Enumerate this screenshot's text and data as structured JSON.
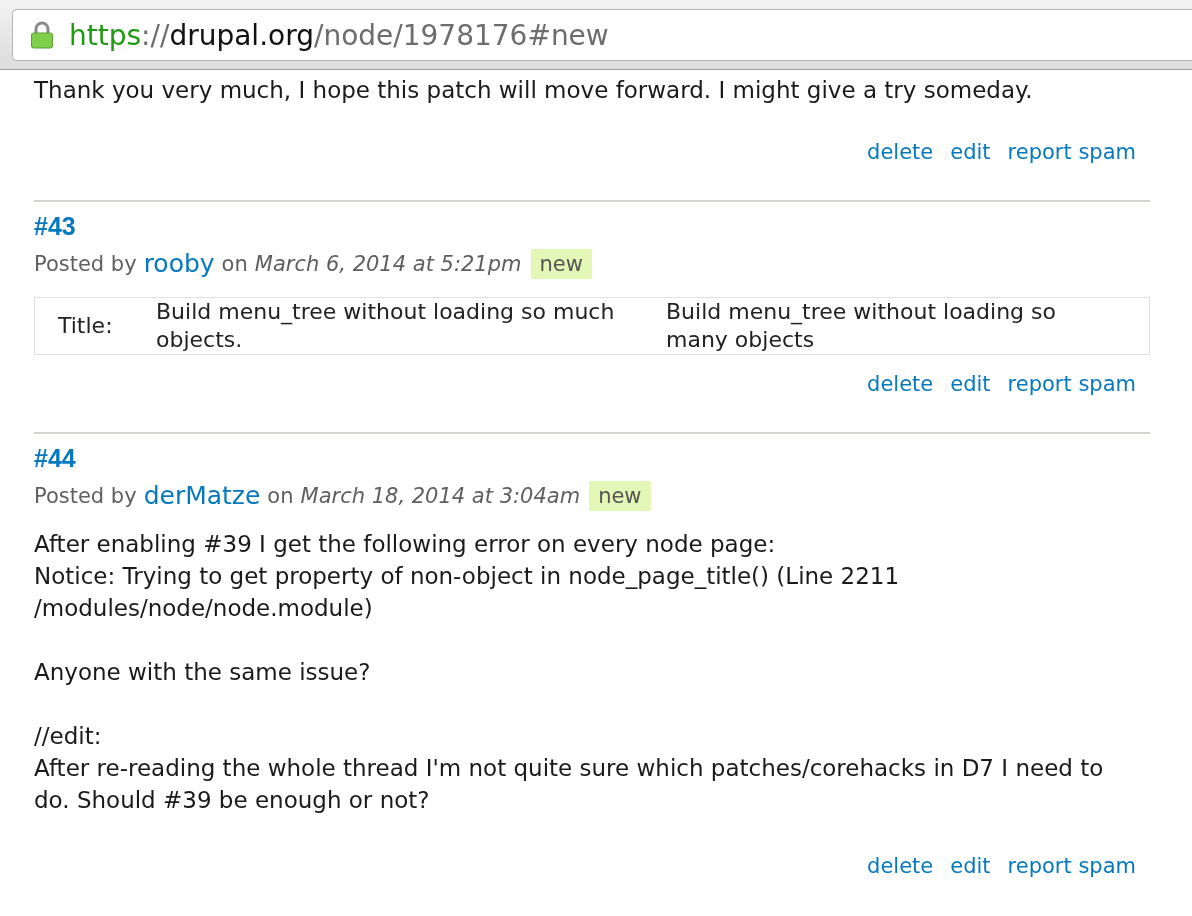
{
  "address_bar": {
    "secure": true,
    "scheme": "https",
    "separator": "://",
    "domain": "drupal.org",
    "path": "/node/1978176#new"
  },
  "comments": [
    {
      "paragraphs": [
        [
          "Thank you very much, I hope this patch will move forward. I might give a try someday."
        ]
      ],
      "links": [
        "delete",
        "edit",
        "report spam"
      ]
    },
    {
      "number": "#43",
      "posted_by": "Posted by",
      "author": "rooby",
      "on": "on",
      "date": "March 6, 2014 at 5:21pm",
      "badge": "new",
      "changes": [
        {
          "label": "Title:",
          "old": "Build menu_tree without loading so much objects.",
          "new": "Build menu_tree without loading so many objects"
        }
      ],
      "links": [
        "delete",
        "edit",
        "report spam"
      ]
    },
    {
      "number": "#44",
      "posted_by": "Posted by",
      "author": "derMatze",
      "on": "on",
      "date": "March 18, 2014 at 3:04am",
      "badge": "new",
      "paragraphs": [
        [
          "After enabling #39 I get the following error on every node page:",
          "Notice: Trying to get property of non-object in node_page_title() (Line 2211 /modules/node/node.module)"
        ],
        [
          "Anyone with the same issue?"
        ],
        [
          "//edit:",
          "After re-reading the whole thread I'm not quite sure which patches/corehacks in D7 I need to do. Should #39 be enough or not?"
        ]
      ],
      "links": [
        "delete",
        "edit",
        "report spam"
      ]
    }
  ]
}
